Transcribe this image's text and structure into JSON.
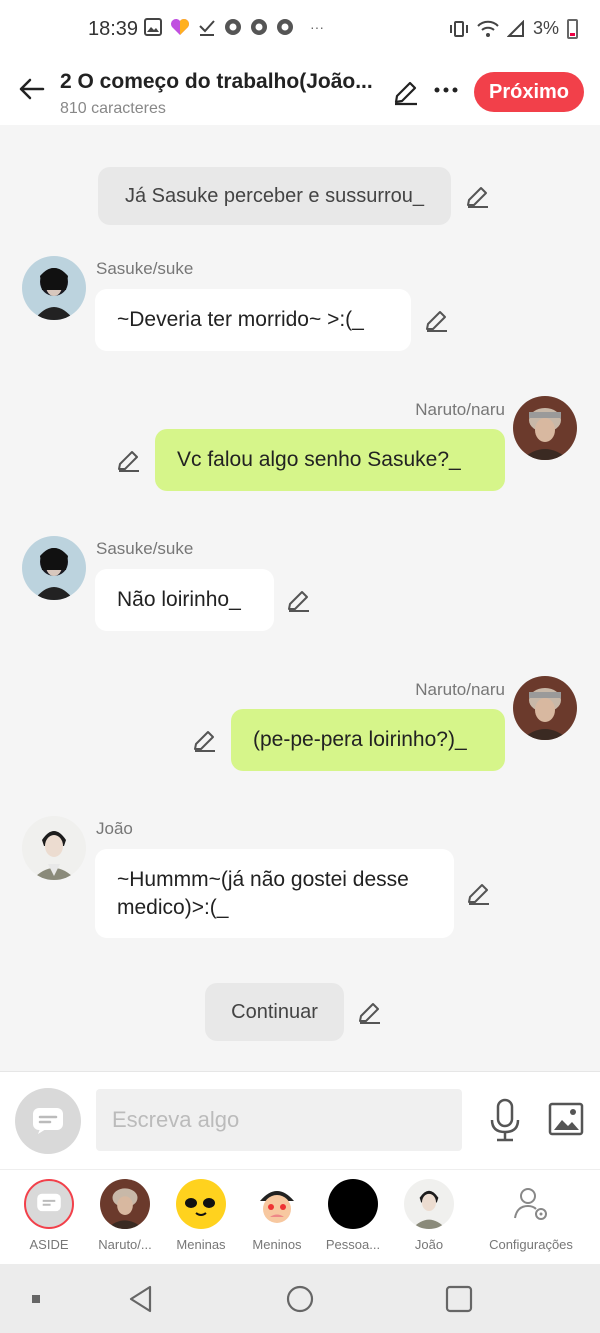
{
  "status_bar": {
    "time": "18:39",
    "more": "···",
    "battery_percent": "3%"
  },
  "header": {
    "title": "2 O começo do trabalho(João...",
    "subtitle": "810 caracteres",
    "next_label": "Próximo",
    "accent_color": "#f2404a"
  },
  "chat": {
    "messages": [
      {
        "kind": "narration",
        "text": "Já Sasuke perceber e sussurrou_"
      },
      {
        "kind": "left",
        "sender": "Sasuke/suke",
        "text": "~Deveria ter morrido~ >:(_"
      },
      {
        "kind": "right",
        "sender": "Naruto/naru",
        "text": "Vc falou algo senho Sasuke?_"
      },
      {
        "kind": "left",
        "sender": "Sasuke/suke",
        "text": "Não loirinho_"
      },
      {
        "kind": "right",
        "sender": "Naruto/naru",
        "text": "(pe-pe-pera loirinho?)_"
      },
      {
        "kind": "left",
        "sender": "João",
        "text": "~Hummm~(já não gostei desse medico)>:(_"
      },
      {
        "kind": "narration",
        "text": "Continuar"
      }
    ]
  },
  "composer": {
    "placeholder": "Escreva algo"
  },
  "characters": [
    {
      "label": "ASIDE",
      "icon": "aside-icon"
    },
    {
      "label": "Naruto/...",
      "icon": "naruto-avatar"
    },
    {
      "label": "Meninas",
      "icon": "yellow-face-avatar"
    },
    {
      "label": "Meninos",
      "icon": "cartoon-avatar"
    },
    {
      "label": "Pessoa...",
      "icon": "black-avatar"
    },
    {
      "label": "João",
      "icon": "joao-avatar"
    },
    {
      "label": "Configurações",
      "icon": "settings-person-icon"
    }
  ],
  "colors": {
    "right_bubble": "#d6f58a",
    "left_bubble": "#ffffff",
    "narration": "#e8e8e8"
  }
}
